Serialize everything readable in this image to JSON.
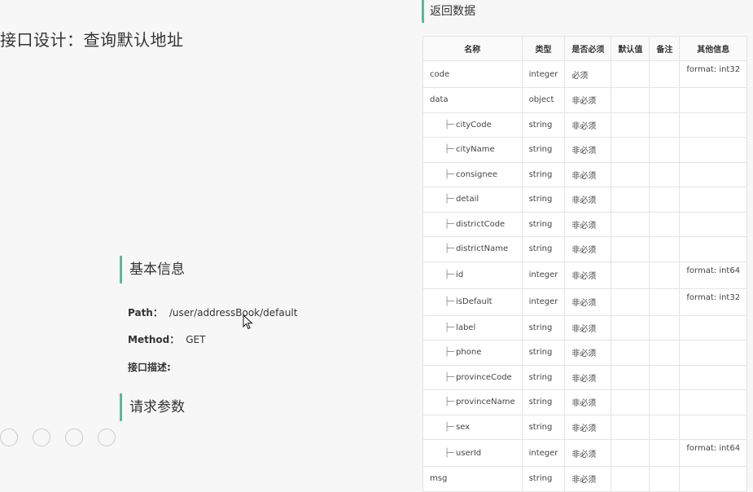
{
  "page": {
    "title": "接口设计：查询默认地址"
  },
  "basic_info": {
    "heading": "基本信息",
    "path_label": "Path：",
    "path_value": "/user/addressBook/default",
    "method_label": "Method：",
    "method_value": "GET",
    "desc_label": "接口描述:"
  },
  "request_params": {
    "heading": "请求参数"
  },
  "response": {
    "heading": "返回数据",
    "columns": [
      "名称",
      "类型",
      "是否必须",
      "默认值",
      "备注",
      "其他信息"
    ],
    "tree_glyph": "├─",
    "rows": [
      {
        "name": "code",
        "type": "integer",
        "required": "必须",
        "default": "",
        "note": "",
        "other": "format: int32",
        "child": false
      },
      {
        "name": "data",
        "type": "object",
        "required": "非必须",
        "default": "",
        "note": "",
        "other": "",
        "child": false
      },
      {
        "name": "cityCode",
        "type": "string",
        "required": "非必须",
        "default": "",
        "note": "",
        "other": "",
        "child": true
      },
      {
        "name": "cityName",
        "type": "string",
        "required": "非必须",
        "default": "",
        "note": "",
        "other": "",
        "child": true
      },
      {
        "name": "consignee",
        "type": "string",
        "required": "非必须",
        "default": "",
        "note": "",
        "other": "",
        "child": true
      },
      {
        "name": "detail",
        "type": "string",
        "required": "非必须",
        "default": "",
        "note": "",
        "other": "",
        "child": true
      },
      {
        "name": "districtCode",
        "type": "string",
        "required": "非必须",
        "default": "",
        "note": "",
        "other": "",
        "child": true
      },
      {
        "name": "districtName",
        "type": "string",
        "required": "非必须",
        "default": "",
        "note": "",
        "other": "",
        "child": true
      },
      {
        "name": "id",
        "type": "integer",
        "required": "非必须",
        "default": "",
        "note": "",
        "other": "format: int64",
        "child": true
      },
      {
        "name": "isDefault",
        "type": "integer",
        "required": "非必须",
        "default": "",
        "note": "",
        "other": "format: int32",
        "child": true
      },
      {
        "name": "label",
        "type": "string",
        "required": "非必须",
        "default": "",
        "note": "",
        "other": "",
        "child": true
      },
      {
        "name": "phone",
        "type": "string",
        "required": "非必须",
        "default": "",
        "note": "",
        "other": "",
        "child": true
      },
      {
        "name": "provinceCode",
        "type": "string",
        "required": "非必须",
        "default": "",
        "note": "",
        "other": "",
        "child": true
      },
      {
        "name": "provinceName",
        "type": "string",
        "required": "非必须",
        "default": "",
        "note": "",
        "other": "",
        "child": true
      },
      {
        "name": "sex",
        "type": "string",
        "required": "非必须",
        "default": "",
        "note": "",
        "other": "",
        "child": true
      },
      {
        "name": "userId",
        "type": "integer",
        "required": "非必须",
        "default": "",
        "note": "",
        "other": "format: int64",
        "child": true
      },
      {
        "name": "msg",
        "type": "string",
        "required": "非必须",
        "default": "",
        "note": "",
        "other": "",
        "child": false
      }
    ]
  },
  "colors": {
    "accent": "#5ab89a"
  }
}
